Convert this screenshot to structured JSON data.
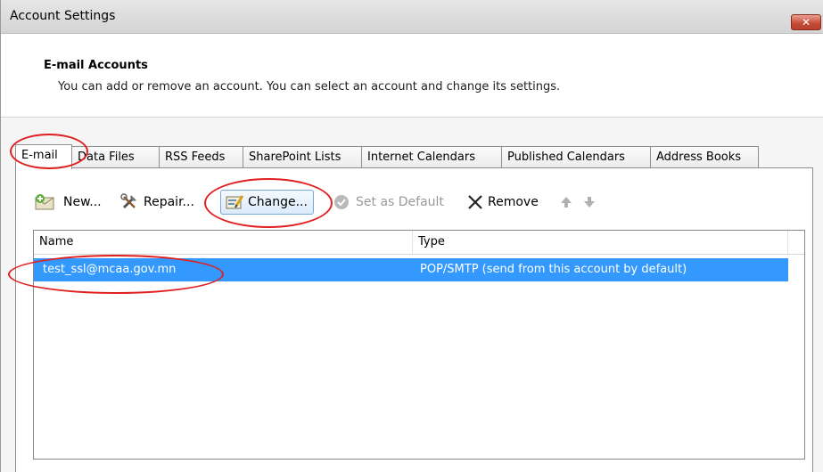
{
  "window": {
    "title": "Account Settings",
    "close_glyph": "✕"
  },
  "header": {
    "title": "E-mail Accounts",
    "description": "You can add or remove an account. You can select an account and change its settings."
  },
  "tabs": [
    {
      "label": "E-mail",
      "active": true
    },
    {
      "label": "Data Files"
    },
    {
      "label": "RSS Feeds"
    },
    {
      "label": "SharePoint Lists"
    },
    {
      "label": "Internet Calendars"
    },
    {
      "label": "Published Calendars"
    },
    {
      "label": "Address Books"
    }
  ],
  "toolbar": {
    "new_label": "New...",
    "repair_label": "Repair...",
    "change_label": "Change...",
    "set_default_label": "Set as Default",
    "remove_label": "Remove"
  },
  "list": {
    "columns": [
      "Name",
      "Type"
    ],
    "rows": [
      {
        "name": "test_ssl@mcaa.gov.mn",
        "type": "POP/SMTP (send from this account by default)",
        "selected": true
      }
    ]
  },
  "colors": {
    "selection": "#3399ff",
    "annotation": "#e02020",
    "close_button": "#c44a35"
  }
}
